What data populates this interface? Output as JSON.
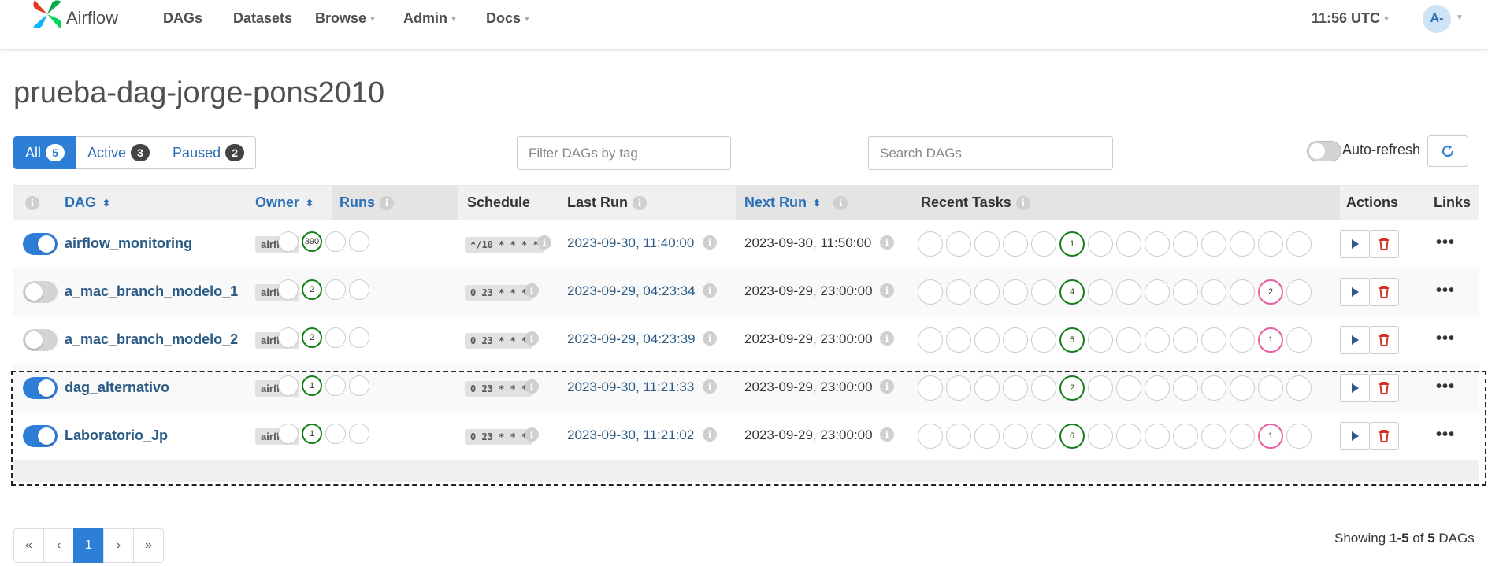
{
  "nav": {
    "brand": "Airflow",
    "items": [
      "DAGs",
      "Datasets",
      "Browse",
      "Admin",
      "Docs"
    ],
    "time": "11:56 UTC",
    "avatar": "A-"
  },
  "page_title": "prueba-dag-jorge-pons2010",
  "filters": {
    "all": {
      "label": "All",
      "count": "5"
    },
    "active": {
      "label": "Active",
      "count": "3"
    },
    "paused": {
      "label": "Paused",
      "count": "2"
    }
  },
  "tag_filter_placeholder": "Filter DAGs by tag",
  "search_placeholder": "Search DAGs",
  "auto_refresh_label": "Auto-refresh",
  "columns": {
    "dag": "DAG",
    "owner": "Owner",
    "runs": "Runs",
    "schedule": "Schedule",
    "last_run": "Last Run",
    "next_run": "Next Run",
    "recent_tasks": "Recent Tasks",
    "actions": "Actions",
    "links": "Links"
  },
  "rows": [
    {
      "name": "airflow_monitoring",
      "on": true,
      "owner": "airflow",
      "runs": [
        "",
        "390",
        "",
        ""
      ],
      "schedule": "*/10 * * * *",
      "last_run": "2023-09-30, 11:40:00",
      "next_run": "2023-09-30, 11:50:00",
      "tasks": [
        "",
        "",
        "",
        "",
        "",
        "1",
        "",
        "",
        "",
        "",
        "",
        "",
        "",
        ""
      ],
      "tasks_failed": [
        "",
        "",
        "",
        "",
        "",
        "",
        "",
        "",
        "",
        "",
        "",
        "",
        "",
        ""
      ]
    },
    {
      "name": "a_mac_branch_modelo_1",
      "on": false,
      "owner": "airflow",
      "runs": [
        "",
        "2",
        "",
        ""
      ],
      "schedule": "0 23 * * *",
      "last_run": "2023-09-29, 04:23:34",
      "next_run": "2023-09-29, 23:00:00",
      "tasks": [
        "",
        "",
        "",
        "",
        "",
        "4",
        "",
        "",
        "",
        "",
        "",
        "",
        "2",
        ""
      ]
    },
    {
      "name": "a_mac_branch_modelo_2",
      "on": false,
      "owner": "airflow",
      "runs": [
        "",
        "2",
        "",
        ""
      ],
      "schedule": "0 23 * * *",
      "last_run": "2023-09-29, 04:23:39",
      "next_run": "2023-09-29, 23:00:00",
      "tasks": [
        "",
        "",
        "",
        "",
        "",
        "5",
        "",
        "",
        "",
        "",
        "",
        "",
        "1",
        ""
      ]
    },
    {
      "name": "dag_alternativo",
      "on": true,
      "owner": "airflow",
      "runs": [
        "",
        "1",
        "",
        ""
      ],
      "schedule": "0 23 * * *",
      "last_run": "2023-09-30, 11:21:33",
      "next_run": "2023-09-29, 23:00:00",
      "tasks": [
        "",
        "",
        "",
        "",
        "",
        "2",
        "",
        "",
        "",
        "",
        "",
        "",
        "",
        ""
      ]
    },
    {
      "name": "Laboratorio_Jp",
      "on": true,
      "owner": "airflow",
      "runs": [
        "",
        "1",
        "",
        ""
      ],
      "schedule": "0 23 * * *",
      "last_run": "2023-09-30, 11:21:02",
      "next_run": "2023-09-29, 23:00:00",
      "tasks": [
        "",
        "",
        "",
        "",
        "",
        "6",
        "",
        "",
        "",
        "",
        "",
        "",
        "1",
        ""
      ]
    }
  ],
  "pagination": {
    "first": "«",
    "prev": "‹",
    "current": "1",
    "next": "›",
    "last": "»"
  },
  "showing": {
    "prefix": "Showing",
    "range": "1-5",
    "of": "of",
    "total": "5",
    "suffix": "DAGs"
  },
  "colors": {
    "accent": "#2c7ed6",
    "success": "#1a7d1a",
    "failed": "#e85fa0",
    "delete": "#d9322b"
  }
}
